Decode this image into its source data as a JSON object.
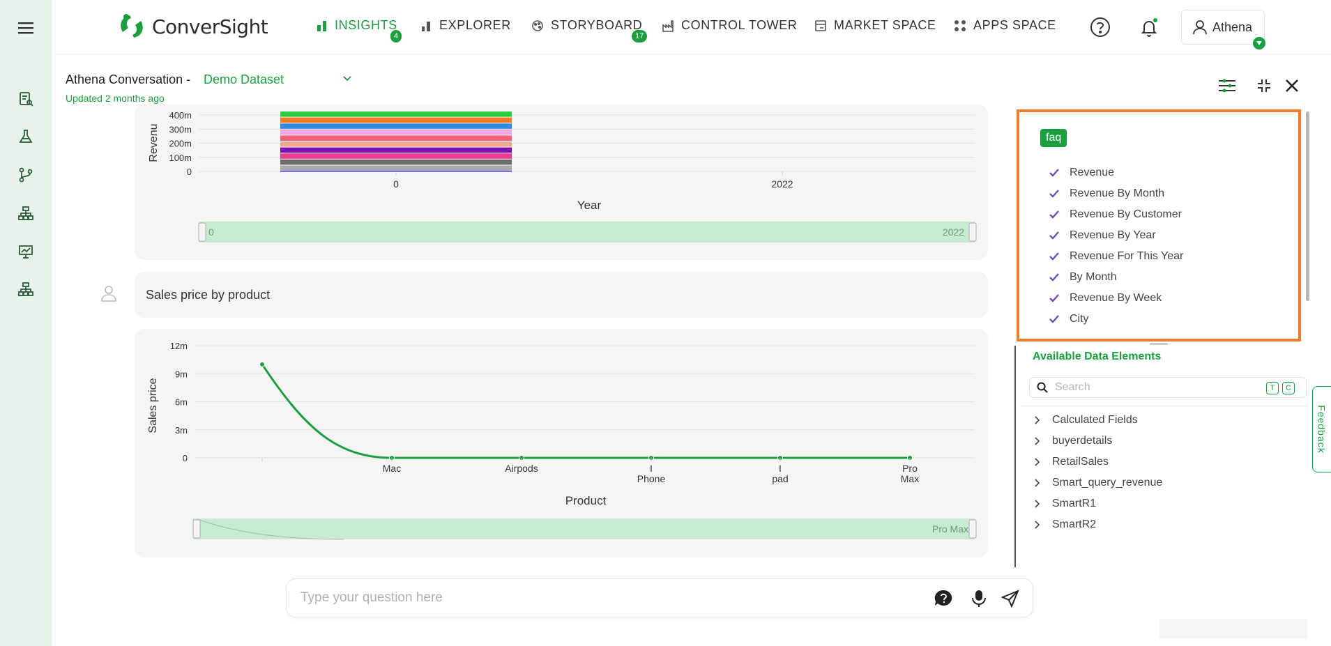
{
  "colors": {
    "brand_green": "#1a9e3e",
    "highlight_orange": "#f07d2b",
    "sidebar_bg": "#e8f3ea"
  },
  "sidebar": {
    "icons": [
      "menu-icon",
      "report-search-icon",
      "flask-icon",
      "branch-icon",
      "hierarchy-icon",
      "presentation-chart-icon",
      "org-chart-icon"
    ]
  },
  "brand": {
    "name": "ConverSight"
  },
  "nav": {
    "items": [
      {
        "label": "INSIGHTS",
        "badge": "4",
        "icon": "bar-chart-icon"
      },
      {
        "label": "EXPLORER",
        "icon": "bar-chart-small-icon"
      },
      {
        "label": "STORYBOARD",
        "badge": "17",
        "icon": "palette-icon"
      },
      {
        "label": "CONTROL TOWER",
        "icon": "factory-icon"
      },
      {
        "label": "MARKET SPACE",
        "icon": "store-icon"
      },
      {
        "label": "APPS SPACE",
        "icon": "apps-grid-icon"
      }
    ],
    "user": "Athena"
  },
  "conversation": {
    "title": "Athena Conversation -",
    "dataset": "Demo Dataset",
    "updated": "Updated 2 months ago"
  },
  "chart_data": [
    {
      "type": "bar",
      "stacked": true,
      "xlabel": "Year",
      "ylabel": "Revenu",
      "yticks": [
        "400m",
        "300m",
        "200m",
        "100m",
        "0"
      ],
      "xticks": [
        "0",
        "2022"
      ],
      "range_slider": {
        "start": "0",
        "end": "2022"
      },
      "segment_colors": [
        "#2ecc40",
        "#f47c20",
        "#2d8fe3",
        "#f3a6e6",
        "#f06277",
        "#f5a990",
        "#7e0fb0",
        "#ea3b8f",
        "#6d6d6d",
        "#a9a9a9"
      ]
    },
    {
      "type": "line",
      "xlabel": "Product",
      "ylabel": "Sales price",
      "categories": [
        "",
        "Mac",
        "Airpods",
        "I Phone",
        "I pad",
        "Pro Max"
      ],
      "category_lines": [
        [
          ""
        ],
        [
          "Mac"
        ],
        [
          "Airpods"
        ],
        [
          "I",
          "Phone"
        ],
        [
          "I",
          "pad"
        ],
        [
          "Pro",
          "Max"
        ]
      ],
      "values": [
        10000000,
        0,
        0,
        0,
        0,
        0
      ],
      "yticks": [
        "12m",
        "9m",
        "6m",
        "3m",
        "0"
      ],
      "ylim": [
        0,
        12000000
      ],
      "range_slider": {
        "end": "Pro Max"
      },
      "line_color": "#1a9e3e"
    }
  ],
  "message": {
    "text": "Sales price by product"
  },
  "faq": {
    "tag": "faq",
    "items": [
      "Revenue",
      "Revenue By Month",
      "Revenue By Customer",
      "Revenue By Year",
      "Revenue For This Year",
      "By Month",
      "Revenue By Week",
      "City"
    ]
  },
  "data_elements": {
    "title": "Available Data Elements",
    "search_placeholder": "Search",
    "chips": [
      "T",
      "C"
    ],
    "items": [
      "Calculated Fields",
      "buyerdetails",
      "RetailSales",
      "Smart_query_revenue",
      "SmartR1",
      "SmartR2"
    ]
  },
  "feedback": {
    "label": "Feedback"
  },
  "input": {
    "placeholder": "Type your question here"
  }
}
